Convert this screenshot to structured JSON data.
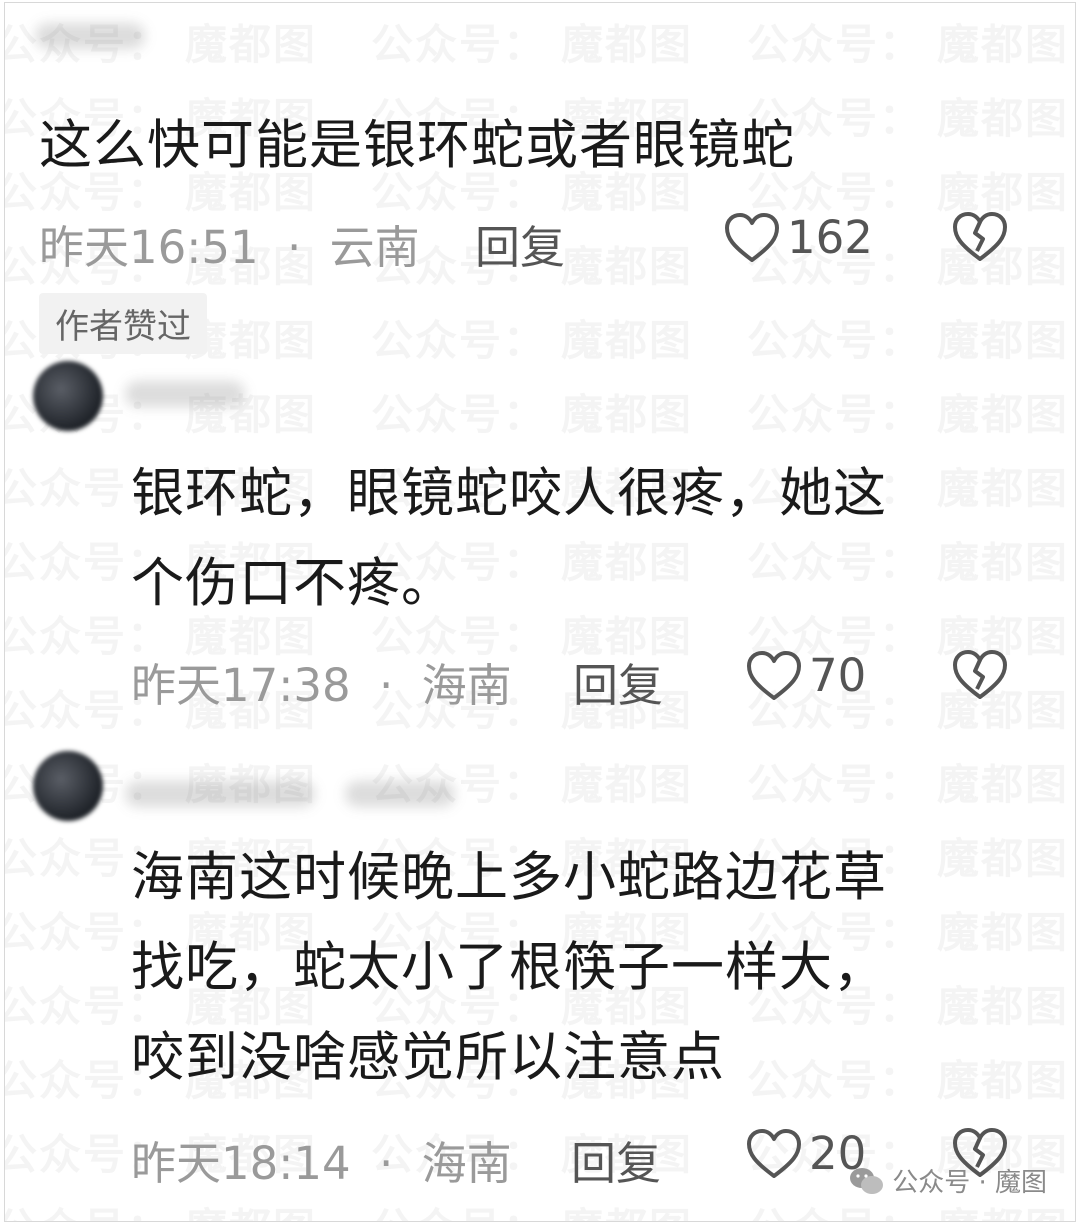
{
  "watermark": {
    "text_a": "公众号：",
    "text_b": "魔都图"
  },
  "comments": [
    {
      "text": "这么快可能是银环蛇或者眼镜蛇",
      "time": "昨天16:51",
      "sep": "·",
      "region": "云南",
      "reply_label": "回复",
      "likes": "162",
      "badge": "作者赞过"
    },
    {
      "text_line1": "银环蛇，眼镜蛇咬人很疼，她这",
      "text_line2": "个伤口不疼。",
      "time": "昨天17:38",
      "sep": "·",
      "region": "海南",
      "reply_label": "回复",
      "likes": "70"
    },
    {
      "text_line1": "海南这时候晚上多小蛇路边花草",
      "text_line2": "找吃，蛇太小了根筷子一样大，",
      "text_line3": "咬到没啥感觉所以注意点",
      "time": "昨天18:14",
      "sep": "·",
      "region": "海南",
      "reply_label": "回复",
      "likes": "20"
    }
  ],
  "icons": {
    "like": "heart-outline-icon",
    "dislike": "broken-heart-icon",
    "brand": "wechat-icon"
  },
  "brand": {
    "label": "公众号 · 魔图"
  },
  "colors": {
    "text": "#1a1a1a",
    "meta": "#9a9a9a",
    "accent_gray": "#555555"
  }
}
